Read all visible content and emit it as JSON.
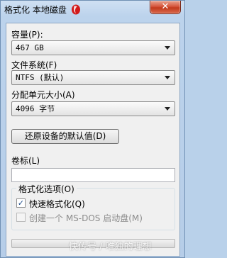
{
  "window": {
    "title": "格式化 本地磁盘",
    "close_label": "✕"
  },
  "capacity": {
    "label": "容量(P):",
    "value": "467 GB"
  },
  "file_system": {
    "label": "文件系统(F)",
    "value": "NTFS (默认)"
  },
  "allocation": {
    "label": "分配单元大小(A)",
    "value": "4096 字节"
  },
  "restore_button": {
    "label": "还原设备的默认值(D)"
  },
  "volume_label": {
    "label": "卷标(L)",
    "value": ""
  },
  "format_options": {
    "legend": "格式化选项(O)",
    "quick_format": {
      "label": "快速格式化(Q)",
      "checked": true
    },
    "ms_dos_disk": {
      "label": "创建一个 MS-DOS 启动盘(M)",
      "checked": false,
      "enabled": false
    }
  },
  "watermark": "快传号 / 唯独的理想",
  "colors": {
    "close_button": "#c7452a",
    "title_bar": "#c4d9ee",
    "client_bg": "#f0f0f0"
  }
}
